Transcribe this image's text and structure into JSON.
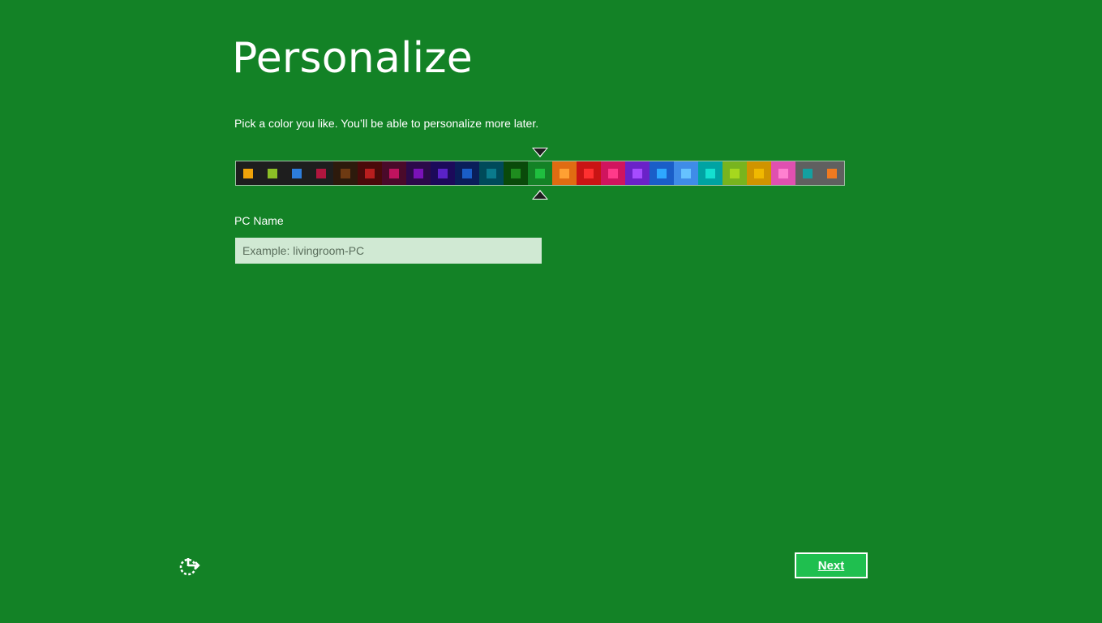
{
  "page": {
    "background": "#138226",
    "title": "Personalize",
    "subtitle": "Pick a color you like. You’ll be able to personalize more later."
  },
  "palette": {
    "selected_index": 12,
    "swatches": [
      {
        "bg": "#1e1e1e",
        "fg": "#f0a30a"
      },
      {
        "bg": "#1e1e1e",
        "fg": "#8cbf26"
      },
      {
        "bg": "#1e1e1e",
        "fg": "#2d7ddb"
      },
      {
        "bg": "#1e1e1e",
        "fg": "#b0163e"
      },
      {
        "bg": "#2d1a0c",
        "fg": "#6e3a12"
      },
      {
        "bg": "#4a0a0a",
        "fg": "#b81e1e"
      },
      {
        "bg": "#4a0a2a",
        "fg": "#c0135e"
      },
      {
        "bg": "#2c0a4a",
        "fg": "#7a12b8"
      },
      {
        "bg": "#1c0a5a",
        "fg": "#5a22c8"
      },
      {
        "bg": "#0a1e5a",
        "fg": "#1a5ec8"
      },
      {
        "bg": "#004a5a",
        "fg": "#0a7a8c"
      },
      {
        "bg": "#0a4a0a",
        "fg": "#1e8c1e"
      },
      {
        "bg": "#138226",
        "fg": "#1fbf3f"
      },
      {
        "bg": "#e06c12",
        "fg": "#ffa033"
      },
      {
        "bg": "#c91414",
        "fg": "#ff3030"
      },
      {
        "bg": "#d0145e",
        "fg": "#ff3a8a"
      },
      {
        "bg": "#6a22c8",
        "fg": "#a64cff"
      },
      {
        "bg": "#1a5ec8",
        "fg": "#2ea8ff"
      },
      {
        "bg": "#3f8ce8",
        "fg": "#66c2ff"
      },
      {
        "bg": "#00a3a3",
        "fg": "#14e0d0"
      },
      {
        "bg": "#78b41e",
        "fg": "#a6d81e"
      },
      {
        "bg": "#d09400",
        "fg": "#f0b800"
      },
      {
        "bg": "#e050b0",
        "fg": "#ff80d0"
      },
      {
        "bg": "#606060",
        "fg": "#14a0a0"
      },
      {
        "bg": "#606060",
        "fg": "#f07a20"
      }
    ]
  },
  "pc_name": {
    "label": "PC Name",
    "placeholder": "Example: livingroom-PC",
    "value": ""
  },
  "footer": {
    "ease_of_access_icon": "ease-of-access-icon",
    "next_label": "Next",
    "next_button_bg": "#1fbf4f"
  }
}
